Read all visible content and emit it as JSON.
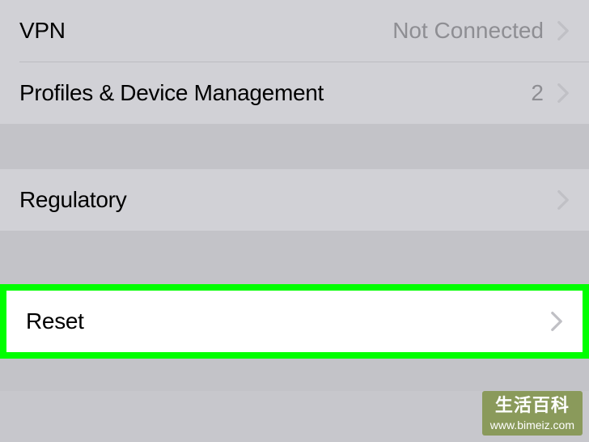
{
  "rows": {
    "vpn": {
      "label": "VPN",
      "value": "Not Connected"
    },
    "profiles": {
      "label": "Profiles & Device Management",
      "value": "2"
    },
    "regulatory": {
      "label": "Regulatory"
    },
    "reset": {
      "label": "Reset"
    }
  },
  "watermark": {
    "main": "生活百科",
    "url": "www.bimeiz.com"
  }
}
